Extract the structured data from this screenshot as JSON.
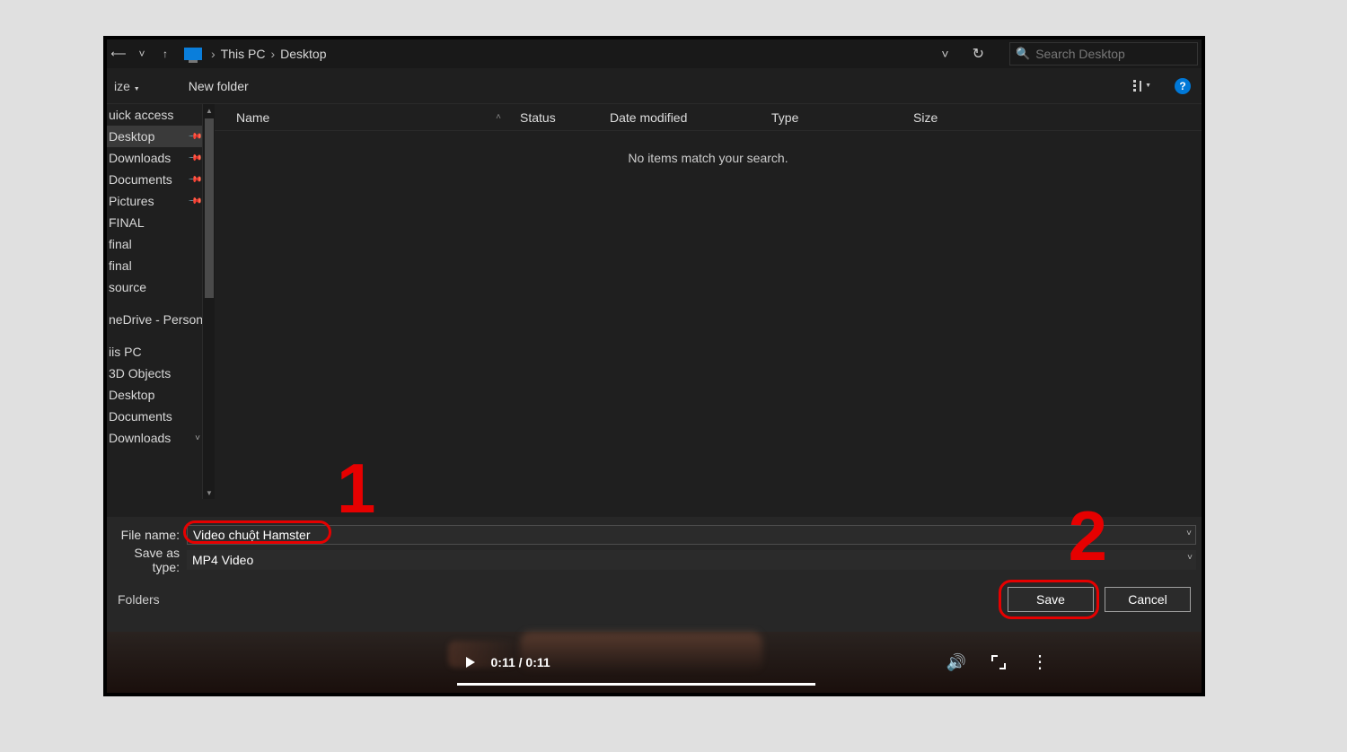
{
  "breadcrumbs": {
    "pc": "This PC",
    "loc": "Desktop"
  },
  "addrbar": {
    "search_placeholder": "Search Desktop"
  },
  "toolbar": {
    "organize": "ize",
    "new_folder": "New folder",
    "help": "?"
  },
  "columns": {
    "name": "Name",
    "status": "Status",
    "date": "Date modified",
    "type": "Type",
    "size": "Size"
  },
  "sidebar": {
    "quick": "uick access",
    "items": [
      {
        "label": "Desktop",
        "pin": true,
        "sel": true
      },
      {
        "label": "Downloads",
        "pin": true
      },
      {
        "label": "Documents",
        "pin": true
      },
      {
        "label": "Pictures",
        "pin": true
      },
      {
        "label": "FINAL"
      },
      {
        "label": "final"
      },
      {
        "label": "final"
      },
      {
        "label": "source"
      }
    ],
    "onedrive": "neDrive - Person",
    "thispc": "iis PC",
    "pcitems": [
      {
        "label": "3D Objects"
      },
      {
        "label": "Desktop"
      },
      {
        "label": "Documents"
      },
      {
        "label": "Downloads"
      }
    ]
  },
  "listing": {
    "empty": "No items match your search."
  },
  "bottom": {
    "file_name_label": "File name:",
    "file_name_value": "Video chuột Hamster",
    "save_type_label": "Save as type:",
    "save_type_value": "MP4 Video",
    "hide_folders": "Folders",
    "save": "Save",
    "cancel": "Cancel"
  },
  "annotations": {
    "n1": "1",
    "n2": "2"
  },
  "video": {
    "time": "0:11 / 0:11"
  }
}
